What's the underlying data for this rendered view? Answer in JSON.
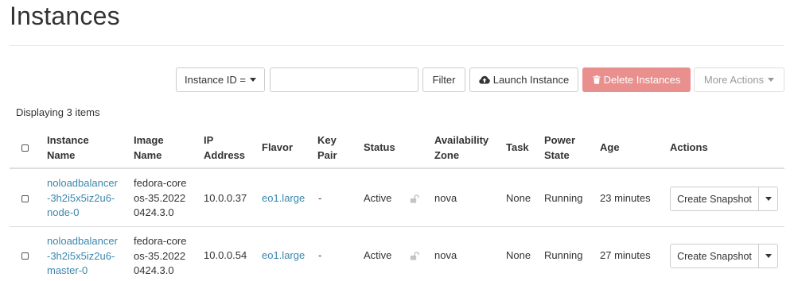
{
  "page": {
    "title": "Instances"
  },
  "toolbar": {
    "filter_field": "Instance ID =",
    "search_value": "",
    "search_placeholder": "",
    "filter_label": "Filter",
    "launch_label": "Launch Instance",
    "delete_label": "Delete Instances",
    "more_label": "More Actions"
  },
  "table": {
    "count_text": "Displaying 3 items",
    "columns": {
      "name": [
        "Instance",
        "Name"
      ],
      "image": [
        "Image",
        "Name"
      ],
      "ip": [
        "IP",
        "Address"
      ],
      "flavor": "Flavor",
      "keypair": [
        "Key",
        "Pair"
      ],
      "status": "Status",
      "zone": [
        "Availability",
        "Zone"
      ],
      "task": "Task",
      "power": [
        "Power",
        "State"
      ],
      "age": "Age",
      "actions": "Actions"
    },
    "rows": [
      {
        "name": [
          "noloadbalancer",
          "-3h2i5x5iz2u6-",
          "node-0"
        ],
        "image": [
          "fedora-core",
          "os-35.2022",
          "0424.3.0"
        ],
        "ip": "10.0.0.37",
        "flavor": "eo1.large",
        "keypair": "-",
        "status": "Active",
        "zone": "nova",
        "task": "None",
        "power": "Running",
        "age": "23 minutes",
        "action": "Create Snapshot"
      },
      {
        "name": [
          "noloadbalancer",
          "-3h2i5x5iz2u6-",
          "master-0"
        ],
        "image": [
          "fedora-core",
          "os-35.2022",
          "0424.3.0"
        ],
        "ip": "10.0.0.54",
        "flavor": "eo1.large",
        "keypair": "-",
        "status": "Active",
        "zone": "nova",
        "task": "None",
        "power": "Running",
        "age": "27 minutes",
        "action": "Create Snapshot"
      }
    ]
  },
  "colors": {
    "link": "#3a87ad",
    "danger": "#e9908e",
    "border": "#dddddd"
  },
  "icons": {
    "launch": "cloud-upload-icon",
    "delete": "trash-icon",
    "lock": "unlocked-icon"
  }
}
